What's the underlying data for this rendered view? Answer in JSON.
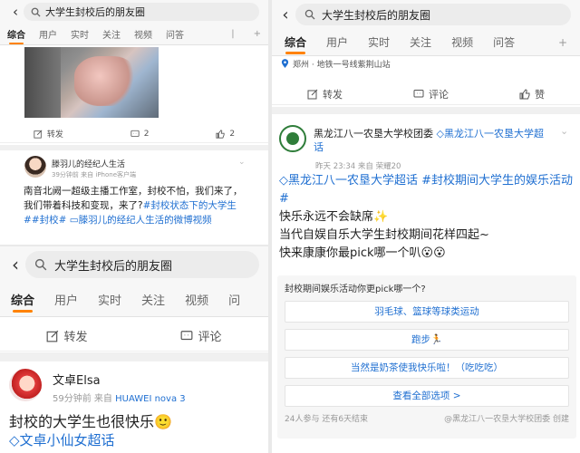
{
  "colors": {
    "accent": "#ff8200",
    "link": "#1f6fd1"
  },
  "icons": {
    "back": "chevron-left-icon",
    "search": "search-icon",
    "repost": "repost-icon",
    "comment": "comment-icon",
    "like": "thumbs-up-icon",
    "more": "chevron-down-icon",
    "location": "location-pin-icon",
    "topic": "diamond-icon"
  },
  "p1": {
    "search": "大学生封校后的朋友圈",
    "tabs": [
      "综合",
      "用户",
      "实时",
      "关注",
      "视频",
      "问答"
    ],
    "actions": {
      "repost": "转发",
      "comment": "2",
      "like": "2"
    },
    "post": {
      "name": "滕羽儿的经纪人生活",
      "time": "39分钟前",
      "source_prefix": "来自",
      "source": "iPhone客户端",
      "text_a": "南音北阙一超级主播工作室，封校不怕，我们来了，我们带着科技和变现，来了?",
      "tag1": "#封校状态下的大学生#",
      "tag2": "#封校#",
      "link": "滕羽儿的经纪人生活的微博视频"
    }
  },
  "p2": {
    "search": "大学生封校后的朋友圈",
    "tabs": [
      "综合",
      "用户",
      "实时",
      "关注",
      "视频",
      "问"
    ],
    "actions": {
      "repost": "转发",
      "comment": "评论"
    },
    "post": {
      "name": "文卓Elsa",
      "time": "59分钟前",
      "source_prefix": "来自",
      "device": "HUAWEI nova 3",
      "text": "封校的大学生也很快乐🙂",
      "tag": "文卓小仙女超话"
    }
  },
  "p3": {
    "search": "大学生封校后的朋友圈",
    "tabs": [
      "综合",
      "用户",
      "实时",
      "关注",
      "视频",
      "问答"
    ],
    "location": "郑州 · 地铁一号线紫荆山站",
    "actions": {
      "repost": "转发",
      "comment": "评论",
      "like": "赞"
    },
    "post": {
      "name": "黑龙江八一农垦大学校团委",
      "name_tag": "黑龙江八一农垦大学超话",
      "time": "昨天 23:34",
      "source_prefix": "来自",
      "source": "荣耀20",
      "tag1": "黑龙江八一农垦大学超话",
      "tag2": "#封校期间大学生的娱乐活动#",
      "line1": "快乐永远不会缺席✨",
      "line2": "当代自娱自乐大学生封校期间花样四起~",
      "line3": "快来康康你最pick哪一个叭😮😮"
    },
    "poll": {
      "question": "封校期间娱乐活动你更pick哪一个?",
      "options": [
        "羽毛球、篮球等球类运动",
        "跑步🏃",
        "当然是奶茶使我快乐啦！（吃吃吃）",
        "查看全部选项 >"
      ],
      "participants": "24人参与",
      "remaining": "还有6天结束",
      "creator": "@黑龙江八一农垦大学校团委 创建"
    }
  }
}
